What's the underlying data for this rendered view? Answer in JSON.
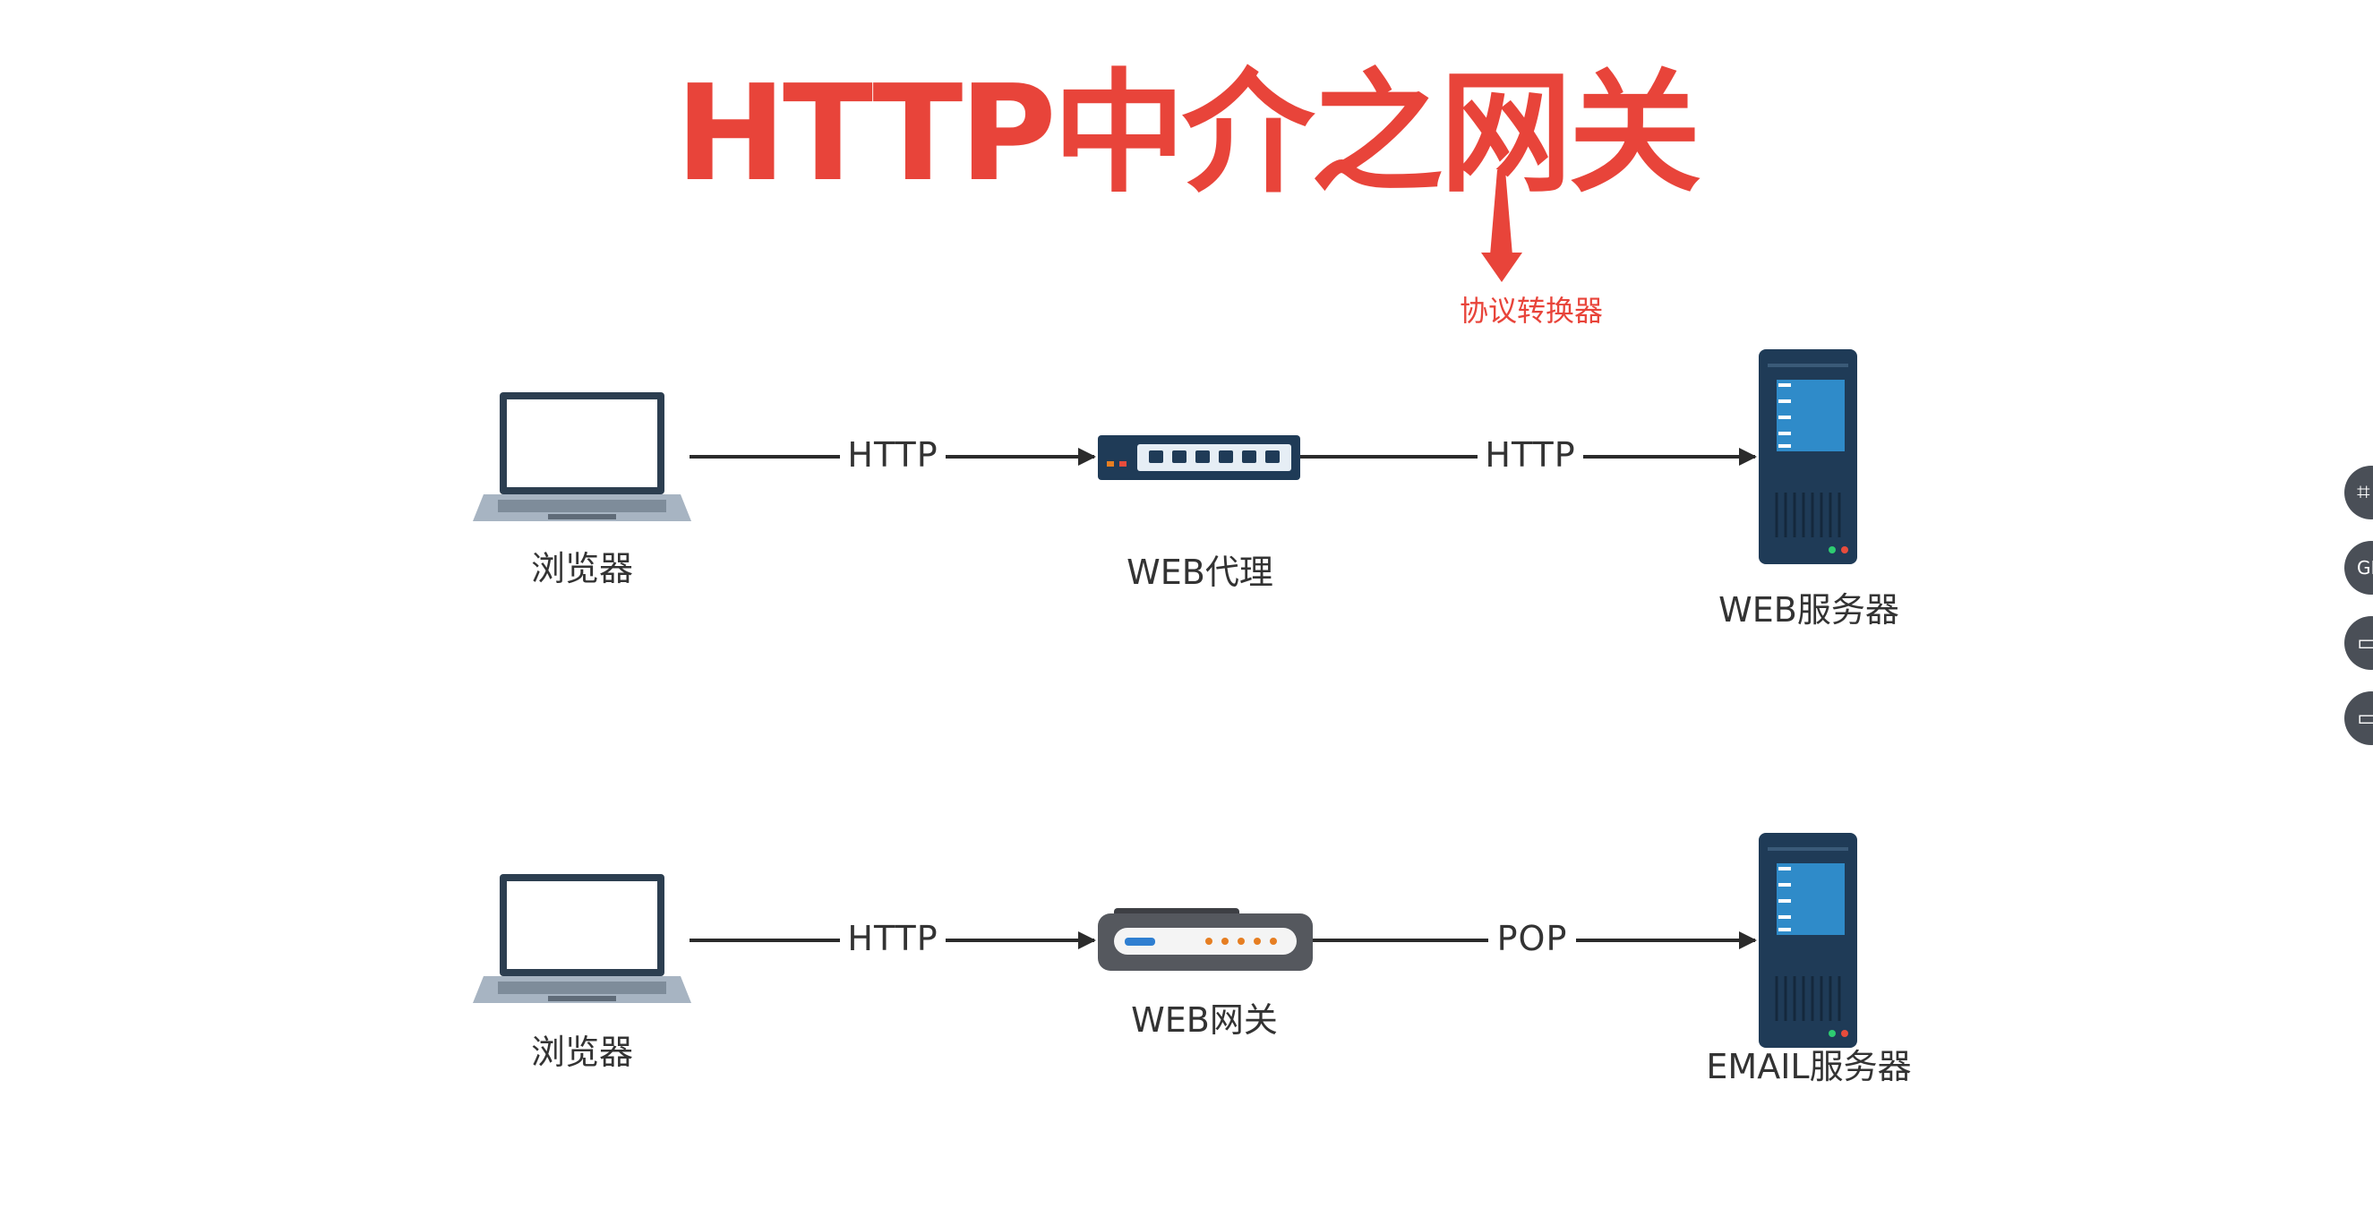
{
  "title": "HTTP中介之网关",
  "annotation": "协议转换器",
  "row1": {
    "client_label": "浏览器",
    "edge1_label": "HTTP",
    "middle_label": "WEB代理",
    "edge2_label": "HTTP",
    "server_label": "WEB服务器"
  },
  "row2": {
    "client_label": "浏览器",
    "edge1_label": "HTTP",
    "middle_label": "WEB网关",
    "edge2_label": "POP",
    "server_label": "EMAIL服务器"
  },
  "side_toolbar": [
    {
      "icon": "crop-icon",
      "glyph": "⌗"
    },
    {
      "icon": "gif-icon",
      "glyph": "GIF"
    },
    {
      "icon": "clipboard-icon",
      "glyph": "▭"
    },
    {
      "icon": "screen-icon",
      "glyph": "▭"
    }
  ],
  "colors": {
    "title": "#e8443a",
    "line": "#2b2b2b",
    "server": "#1f3b57",
    "server_accent": "#2f8bc9",
    "laptop_frame": "#2c3e50",
    "laptop_base": "#a7b4c2"
  }
}
